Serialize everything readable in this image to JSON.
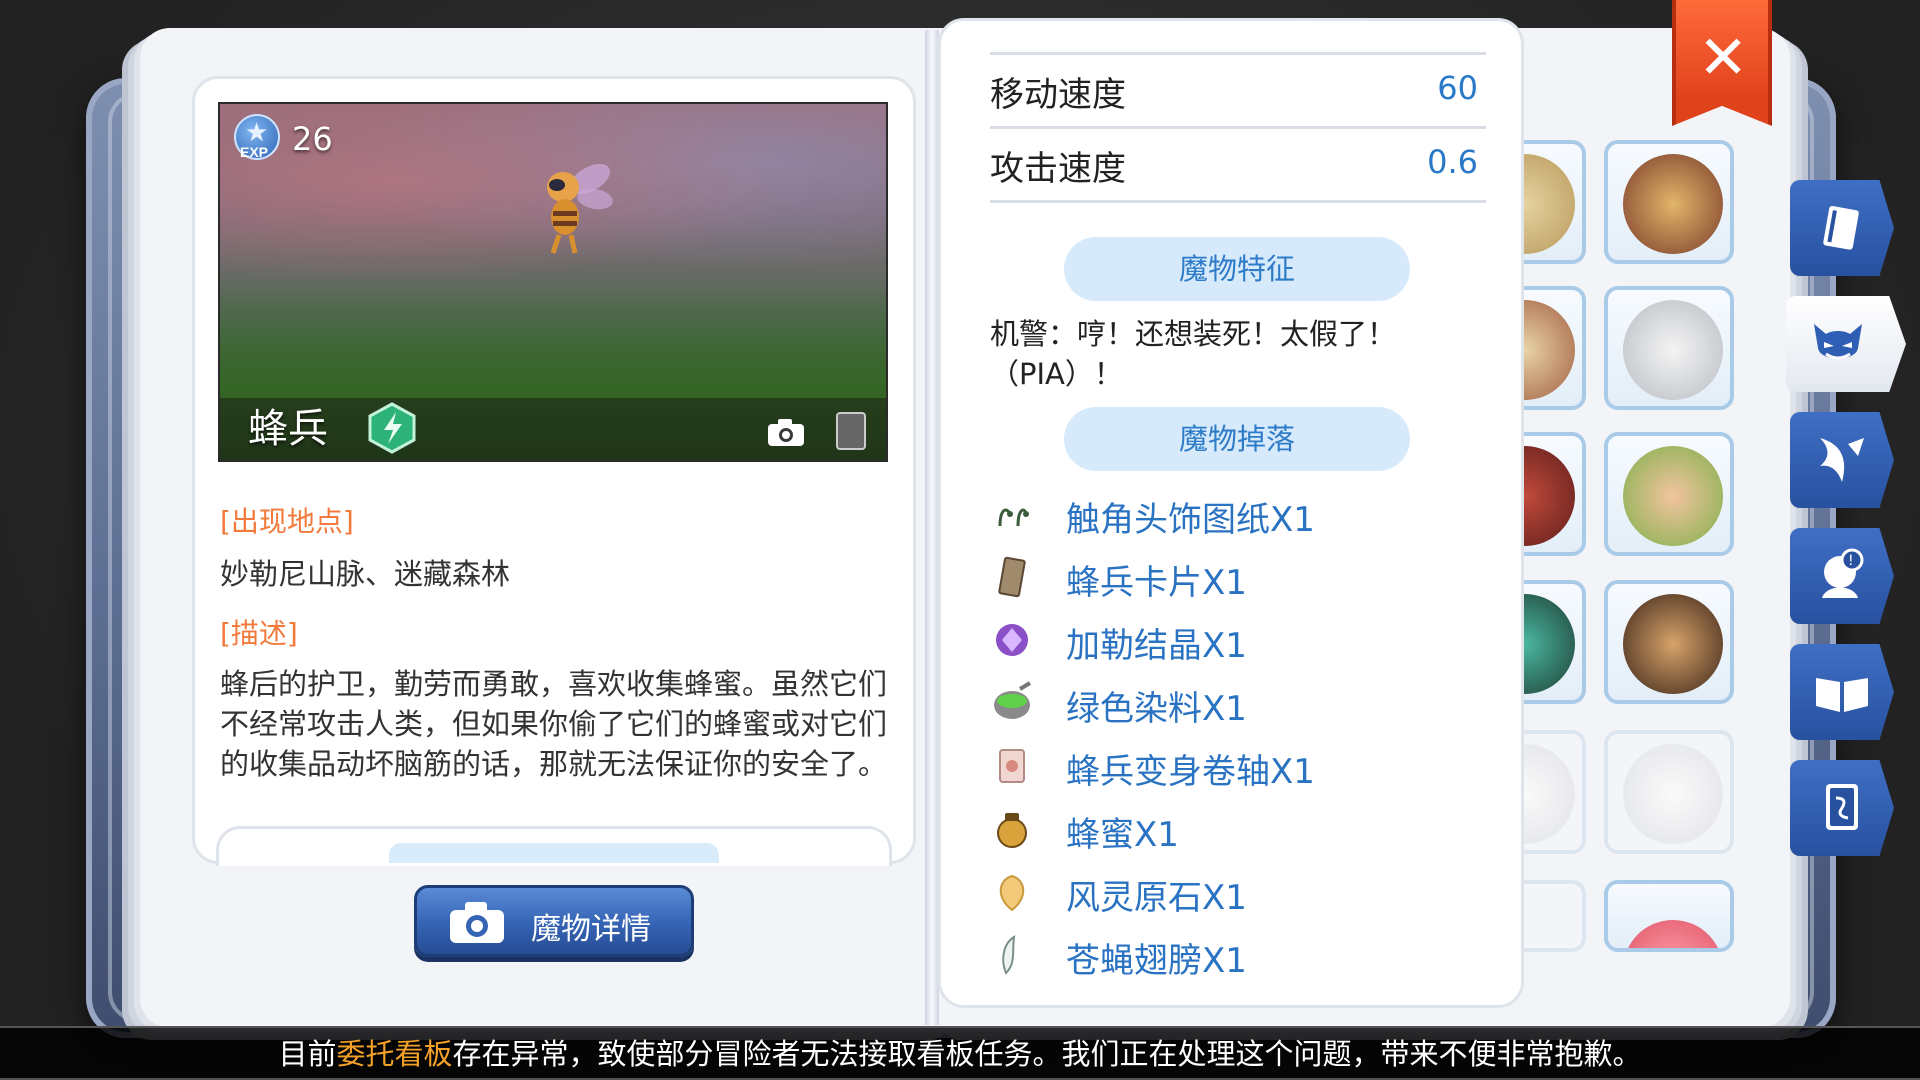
{
  "close_label": "✕",
  "monster": {
    "exp_label": "EXP",
    "exp_value": "26",
    "name": "蜂兵"
  },
  "location": {
    "label": "[出现地点]",
    "value": "妙勒尼山脉、迷藏森林"
  },
  "description": {
    "label": "[描述]",
    "text": "蜂后的护卫，勤劳而勇敢，喜欢收集蜂蜜。虽然它们不经常攻击人类，但如果你偷了它们的蜂蜜或对它们的收集品动坏脑筋的话，那就无法保证你的安全了。"
  },
  "detail_button": "魔物详情",
  "stats": [
    {
      "label": "移动速度",
      "value": "60"
    },
    {
      "label": "攻击速度",
      "value": "0.6"
    }
  ],
  "features_header": "魔物特征",
  "feature_quote": "机警：哼！还想装死！太假了！（PIA）！",
  "drops_header": "魔物掉落",
  "drops": [
    {
      "name": "触角头饰图纸X1",
      "icon": "antenna-icon"
    },
    {
      "name": "蜂兵卡片X1",
      "icon": "card-icon"
    },
    {
      "name": "加勒结晶X1",
      "icon": "crystal-icon"
    },
    {
      "name": "绿色染料X1",
      "icon": "dye-bowl-icon"
    },
    {
      "name": "蜂兵变身卷轴X1",
      "icon": "scroll-icon"
    },
    {
      "name": "蜂蜜X1",
      "icon": "honey-jar-icon"
    },
    {
      "name": "风灵原石X1",
      "icon": "wind-stone-icon"
    },
    {
      "name": "苍蝇翅膀X1",
      "icon": "fly-wing-icon"
    }
  ],
  "marquee": {
    "before": "目前",
    "highlight": "委托看板",
    "after": "存在异常，致使部分冒险者无法接取看板任务。我们正在处理这个问题，带来不便非常抱歉。"
  },
  "colors": {
    "accent_blue": "#2a79c8",
    "section_orange": "#f27a3c",
    "highlight_orange": "#f4a12a",
    "close_red": "#e0421b"
  }
}
